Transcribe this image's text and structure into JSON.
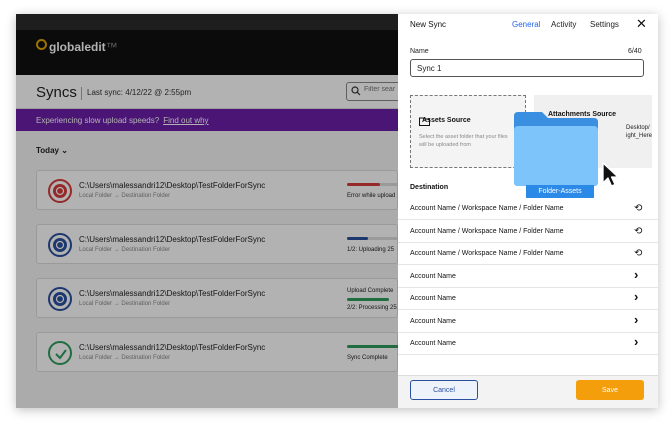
{
  "app": {
    "logo_text": "globaledit",
    "logo_suffix": "™",
    "page_title": "Syncs",
    "last_sync": "Last sync: 4/12/22 @ 2:55pm",
    "filter_placeholder": "Filter sear",
    "banner_text": "Experiencing slow upload speeds?",
    "banner_link": "Find out why",
    "group_label": "Today ⌄",
    "cards": [
      {
        "path": "C:\\Users\\malessandri12\\Desktop\\TestFolderForSync",
        "from": "Local Folder",
        "arrow": "→",
        "to": "Destination Folder",
        "status": "Error while upload",
        "status_top": "",
        "state": "error",
        "progress": 0.55,
        "color": "#d63b3b"
      },
      {
        "path": "C:\\Users\\malessandri12\\Desktop\\TestFolderForSync",
        "from": "Local Folder",
        "arrow": "→",
        "to": "Destination Folder",
        "status": "1/2: Uploading 25",
        "status_top": "",
        "state": "uploading",
        "progress": 0.35,
        "color": "#2a4fa0"
      },
      {
        "path": "C:\\Users\\malessandri12\\Desktop\\TestFolderForSync",
        "from": "Local Folder",
        "arrow": "→",
        "to": "Destination Folder",
        "status": "2/2: Processing 25",
        "status_top": "Upload Complete",
        "state": "processing",
        "progress": 0.7,
        "color": "#2a4fa0"
      },
      {
        "path": "C:\\Users\\malessandri12\\Desktop\\TestFolderForSync",
        "from": "Local Folder",
        "arrow": "→",
        "to": "Destination Folder",
        "status": "Sync Complete",
        "status_top": "",
        "state": "complete",
        "progress": 1.0,
        "color": "#2e9e5b"
      }
    ]
  },
  "panel": {
    "title": "New Sync",
    "tabs": [
      "General",
      "Activity",
      "Settings"
    ],
    "active_tab": "General",
    "close": "✕",
    "name_label": "Name",
    "name_count": "6/40",
    "name_value": "Sync 1",
    "assets_title": "Assets Source",
    "assets_desc": "Select the asset folder that your files will be uploaded from",
    "attach_title": "Attachments Source",
    "attach_path1": "Desktop/",
    "attach_path2": "ight_Here",
    "drag_label": "Folder-Assets",
    "destination_label": "Destination",
    "destinations": [
      {
        "label": "Account Name / Workspace Name / Folder Name",
        "icon": "history-icon"
      },
      {
        "label": "Account Name / Workspace Name / Folder Name",
        "icon": "history-icon"
      },
      {
        "label": "Account Name / Workspace Name / Folder Name",
        "icon": "history-icon"
      },
      {
        "label": "Account Name",
        "icon": "chevron-right-icon"
      },
      {
        "label": "Account Name",
        "icon": "chevron-right-icon"
      },
      {
        "label": "Account Name",
        "icon": "chevron-right-icon"
      },
      {
        "label": "Account Name",
        "icon": "chevron-right-icon"
      }
    ],
    "cancel_label": "Cancel",
    "save_label": "Save"
  },
  "colors": {
    "accent": "#2563eb",
    "banner": "#6b1fa8",
    "save": "#f59e0b",
    "error": "#d63b3b",
    "ok": "#2e9e5b"
  }
}
